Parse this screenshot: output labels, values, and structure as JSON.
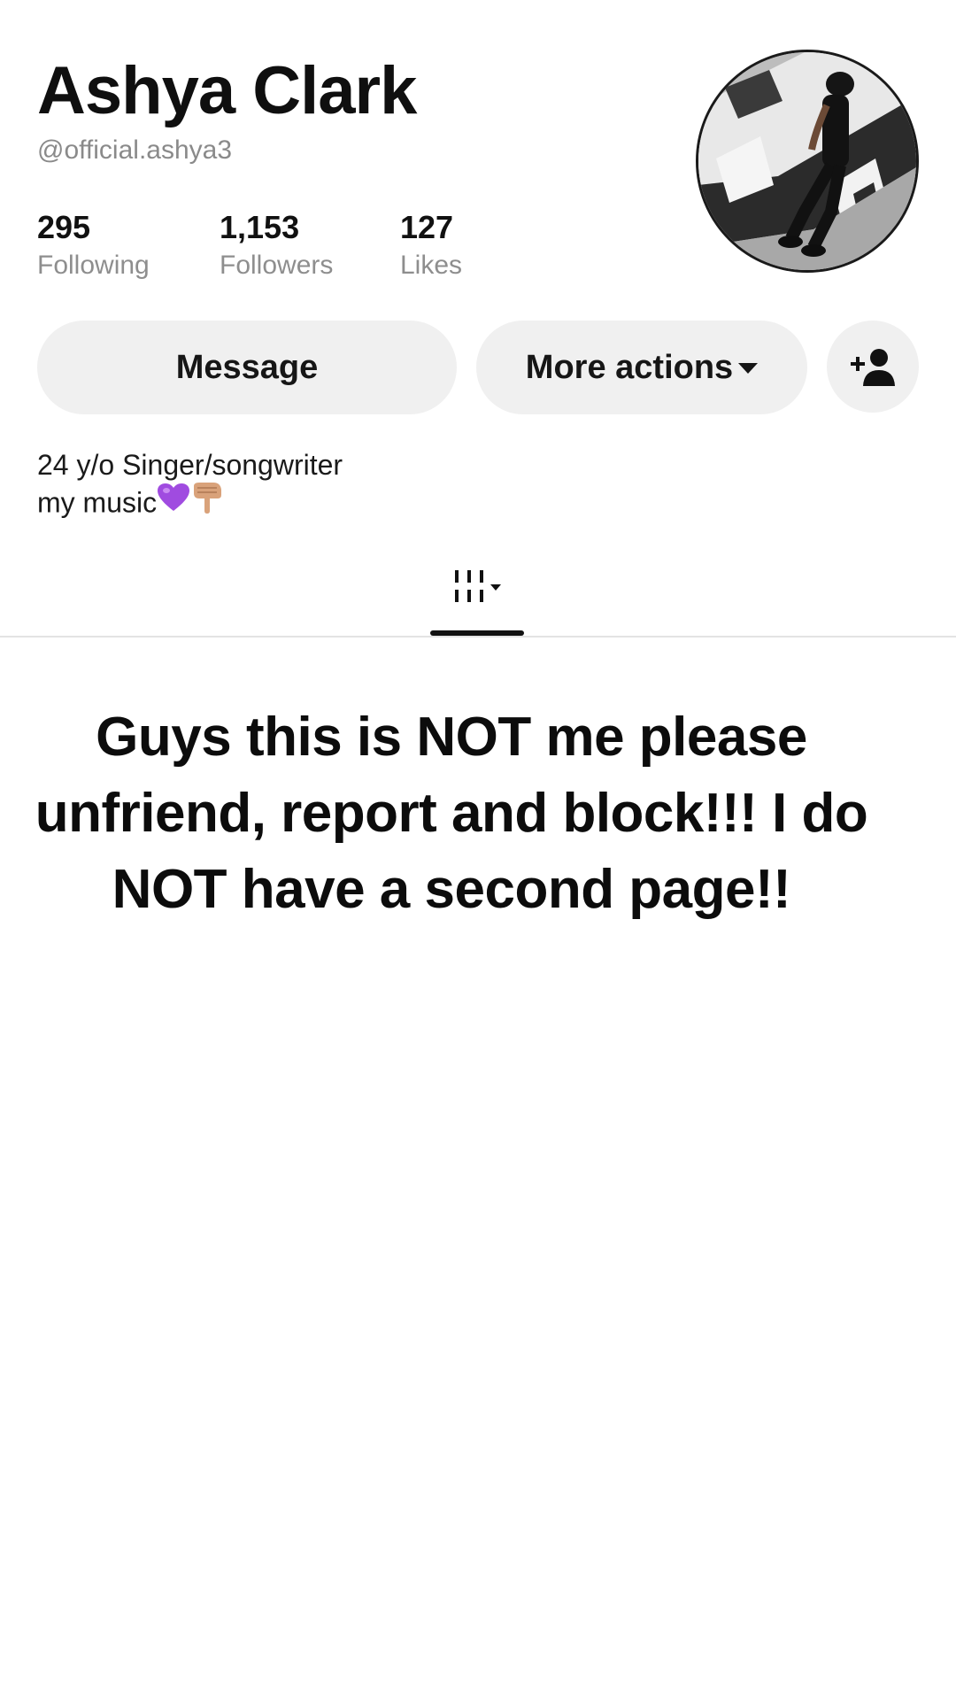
{
  "profile": {
    "name": "Ashya Clark",
    "handle": "@official.ashya3"
  },
  "stats": {
    "following": {
      "value": "295",
      "label": "Following"
    },
    "followers": {
      "value": "1,153",
      "label": "Followers"
    },
    "likes": {
      "value": "127",
      "label": "Likes"
    }
  },
  "actions": {
    "message_label": "Message",
    "more_actions_label": "More actions",
    "add_friend_icon": "add-person-icon"
  },
  "bio": {
    "line1": "24 y/o Singer/songwriter",
    "line2": "my music",
    "line2_emojis": [
      "purple-heart",
      "backhand-index-pointing-down"
    ]
  },
  "tabs": {
    "filter_icon": "grid-filter-icon"
  },
  "overlay": {
    "text": "Guys this is NOT me please unfriend, report and block!!! I do NOT have a second page!!"
  },
  "colors": {
    "background": "#ffffff",
    "button_background": "#f0f0f0",
    "muted_text": "#8a8a8a",
    "primary_text": "#111111"
  }
}
